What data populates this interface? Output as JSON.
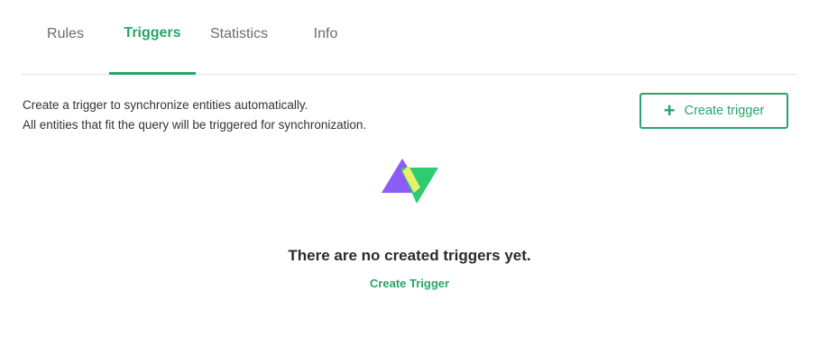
{
  "tabs": [
    {
      "label": "Rules",
      "active": false
    },
    {
      "label": "Triggers",
      "active": true
    },
    {
      "label": "Statistics",
      "active": false
    },
    {
      "label": "Info",
      "active": false
    }
  ],
  "description": {
    "line1": "Create a trigger to synchronize entities automatically.",
    "line2": "All entities that fit the query will be triggered for synchronization."
  },
  "create_button": {
    "icon": "plus-icon",
    "label": "Create trigger"
  },
  "empty_state": {
    "icon": "triangles-logo-icon",
    "title": "There are no created triggers yet.",
    "link_label": "Create Trigger"
  },
  "colors": {
    "accent": "#27a56a",
    "purple": "#8b5cf6",
    "green": "#2ecc71",
    "yellow": "#e8f06a"
  }
}
